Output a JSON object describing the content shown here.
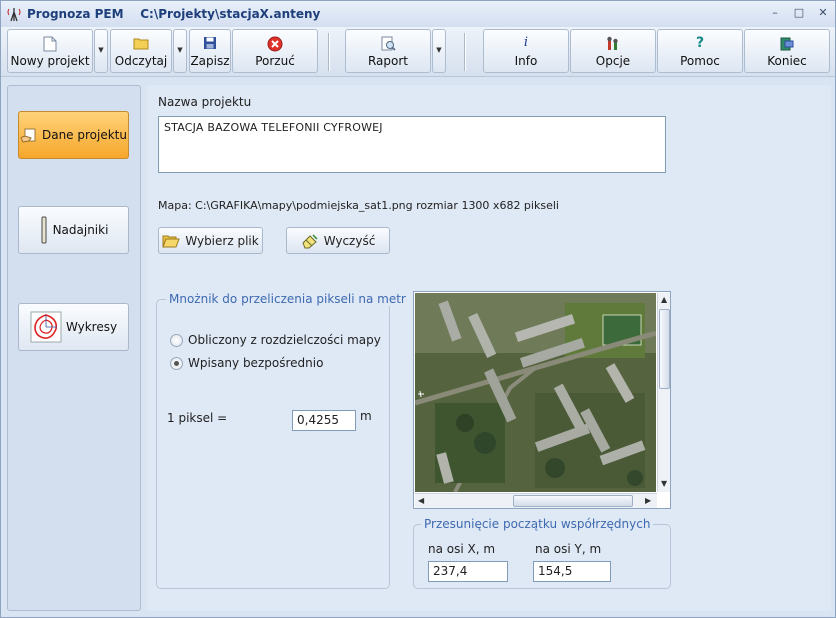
{
  "window": {
    "app_name": "Prognoza PEM",
    "file_path": "C:\\Projekty\\stacjaX.anteny",
    "minimize": "–",
    "maximize": "□",
    "close": "✕"
  },
  "toolbar": {
    "new_project": "Nowy projekt",
    "open": "Odczytaj",
    "save": "Zapisz",
    "discard": "Porzuć",
    "report": "Raport",
    "info": "Info",
    "options": "Opcje",
    "help": "Pomoc",
    "exit": "Koniec"
  },
  "sidebar": {
    "items": [
      {
        "label": "Dane projektu",
        "active": true
      },
      {
        "label": "Nadajniki",
        "active": false
      },
      {
        "label": "Wykresy",
        "active": false
      }
    ]
  },
  "project": {
    "name_label": "Nazwa projektu",
    "name_value": "STACJA BAZOWA TELEFONII CYFROWEJ",
    "map_info": "Mapa: C:\\GRAFIKA\\mapy\\podmiejska_sat1.png rozmiar 1300 x682 pikseli",
    "choose_file": "Wybierz plik",
    "clear": "Wyczyść"
  },
  "multiplier": {
    "title": "Mnożnik  do przeliczenia pikseli na metr",
    "option_computed": "Obliczony z rozdzielczości mapy",
    "option_direct": "Wpisany bezpośrednio",
    "selected": "direct",
    "pixel_label": "1 piksel =",
    "pixel_value": "0,4255",
    "unit": "m"
  },
  "offset": {
    "title": "Przesunięcie początku współrzędnych",
    "x_label": "na osi X, m",
    "y_label": "na osi Y, m",
    "x_value": "237,4",
    "y_value": "154,5"
  },
  "colors": {
    "accent_active": "#f6a72b",
    "group_title": "#3e6ab0",
    "window_bg": "#dfe8f5"
  }
}
